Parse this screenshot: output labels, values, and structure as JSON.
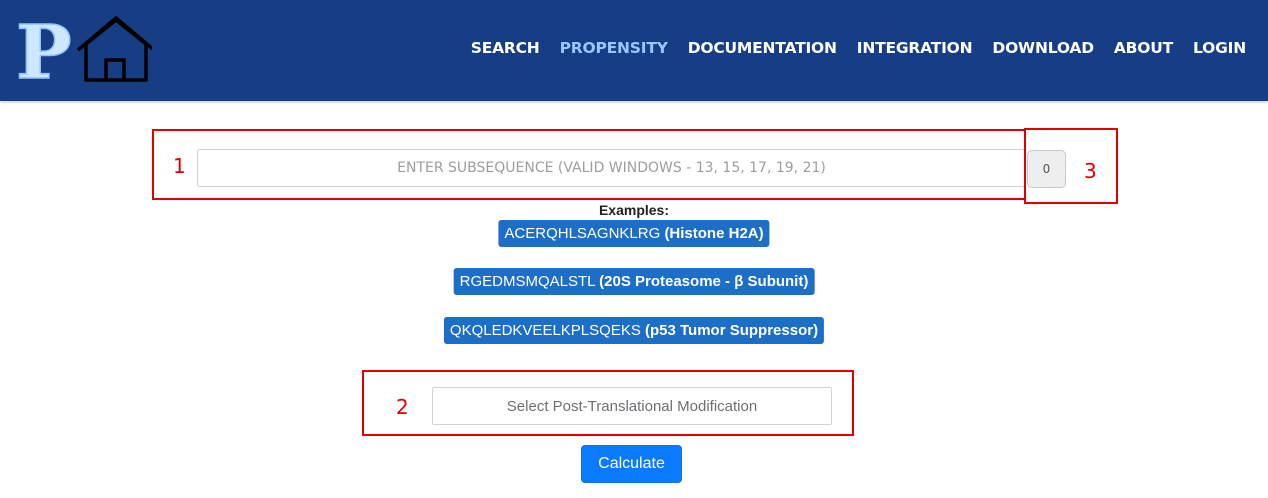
{
  "nav": {
    "items": [
      {
        "label": "SEARCH",
        "active": false
      },
      {
        "label": "PROPENSITY",
        "active": true
      },
      {
        "label": "DOCUMENTATION",
        "active": false
      },
      {
        "label": "INTEGRATION",
        "active": false
      },
      {
        "label": "DOWNLOAD",
        "active": false
      },
      {
        "label": "ABOUT",
        "active": false
      },
      {
        "label": "LOGIN",
        "active": false
      }
    ],
    "logo_text": "P",
    "logo_icon": "house-icon"
  },
  "annotations": [
    "1",
    "2",
    "3"
  ],
  "subsequence": {
    "placeholder": "ENTER SUBSEQUENCE (VALID WINDOWS - 13, 15, 17, 19, 21)",
    "value": "",
    "count": "0"
  },
  "examples": {
    "title": "Examples:",
    "items": [
      {
        "sequence": "ACERQHLSAGNKLRG",
        "name": "(Histone H2A)"
      },
      {
        "sequence": "RGEDMSMQALSTL",
        "name": "(20S Proteasome - β Subunit)"
      },
      {
        "sequence": "QKQLEDKVEELKPLSQEKS",
        "name": "(p53 Tumor Suppressor)"
      }
    ]
  },
  "ptm": {
    "placeholder": "Select Post-Translational Modification"
  },
  "calculate": {
    "label": "Calculate"
  },
  "colors": {
    "navbar": "#173d84",
    "nav_active": "#99c6ff",
    "chip": "#1c6ec7",
    "button": "#0a7bff",
    "annotation": "#e00000"
  }
}
